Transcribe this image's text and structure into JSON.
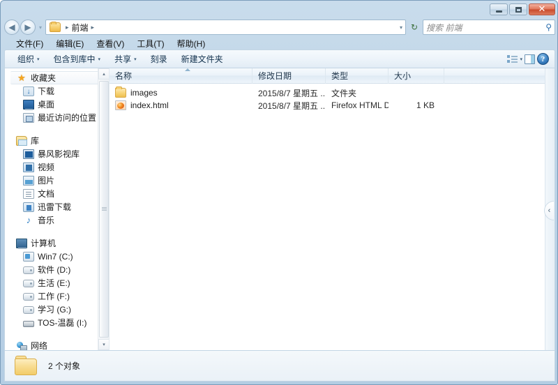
{
  "window": {
    "controls": {
      "minimize": "–",
      "maximize": "□",
      "close": "✕"
    }
  },
  "address": {
    "back_glyph": "◀",
    "forward_glyph": "▶",
    "history_caret": "▾",
    "crumb_sep": "▸",
    "crumb": "前端",
    "dropdown_caret": "▾",
    "refresh_glyph": "↻"
  },
  "search": {
    "placeholder": "搜索 前端",
    "icon_glyph": "⚲"
  },
  "menubar": {
    "items": [
      {
        "label": "文件(F)"
      },
      {
        "label": "编辑(E)"
      },
      {
        "label": "查看(V)"
      },
      {
        "label": "工具(T)"
      },
      {
        "label": "帮助(H)"
      }
    ]
  },
  "toolbar": {
    "items": [
      {
        "label": "组织",
        "caret": "▾"
      },
      {
        "label": "包含到库中",
        "caret": "▾"
      },
      {
        "label": "共享",
        "caret": "▾"
      },
      {
        "label": "刻录",
        "caret": ""
      },
      {
        "label": "新建文件夹",
        "caret": ""
      }
    ],
    "view_caret": "▾",
    "help_label": "?"
  },
  "sidebar": {
    "groups": [
      {
        "header": {
          "label": "收藏夹",
          "icon": "star-icon",
          "selected": true
        },
        "items": [
          {
            "label": "下载",
            "icon": "download-icon"
          },
          {
            "label": "桌面",
            "icon": "desktop-icon"
          },
          {
            "label": "最近访问的位置",
            "icon": "recent-places-icon"
          }
        ]
      },
      {
        "header": {
          "label": "库",
          "icon": "library-icon",
          "selected": false
        },
        "items": [
          {
            "label": "暴风影视库",
            "icon": "movie-library-icon"
          },
          {
            "label": "视频",
            "icon": "video-icon"
          },
          {
            "label": "图片",
            "icon": "pictures-icon"
          },
          {
            "label": "文档",
            "icon": "document-icon"
          },
          {
            "label": "迅雷下载",
            "icon": "thunder-download-icon"
          },
          {
            "label": "音乐",
            "icon": "music-icon"
          }
        ]
      },
      {
        "header": {
          "label": "计算机",
          "icon": "computer-icon",
          "selected": false
        },
        "items": [
          {
            "label": "Win7 (C:)",
            "icon": "system-drive-icon"
          },
          {
            "label": "软件 (D:)",
            "icon": "drive-icon"
          },
          {
            "label": "生活 (E:)",
            "icon": "drive-icon"
          },
          {
            "label": "工作 (F:)",
            "icon": "drive-icon"
          },
          {
            "label": "学习 (G:)",
            "icon": "drive-icon"
          },
          {
            "label": "TOS-温磊 (I:)",
            "icon": "usb-drive-icon"
          }
        ]
      },
      {
        "header": {
          "label": "网络",
          "icon": "network-icon",
          "selected": false
        },
        "items": []
      }
    ],
    "scroll": {
      "up_glyph": "▴",
      "down_glyph": "▾"
    }
  },
  "filelist": {
    "columns": [
      {
        "key": "name",
        "label": "名称"
      },
      {
        "key": "date",
        "label": "修改日期"
      },
      {
        "key": "type",
        "label": "类型"
      },
      {
        "key": "size",
        "label": "大小"
      }
    ],
    "sort": {
      "column": "名称",
      "direction": "ascending"
    },
    "rows": [
      {
        "name": "images",
        "date": "2015/8/7 星期五 ...",
        "type": "文件夹",
        "size": "",
        "icon": "folder-icon"
      },
      {
        "name": "index.html",
        "date": "2015/8/7 星期五 ...",
        "type": "Firefox HTML D...",
        "size": "1 KB",
        "icon": "firefox-html-icon"
      }
    ]
  },
  "details_pane": {
    "collapse_glyph": "‹"
  },
  "statusbar": {
    "text": "2 个对象",
    "icon": "folder-icon"
  },
  "colors": {
    "frame": "#bcd3e6",
    "accent": "#2c6fae",
    "folder_yellow": "#f7d375",
    "close_red": "#c84b2c"
  }
}
